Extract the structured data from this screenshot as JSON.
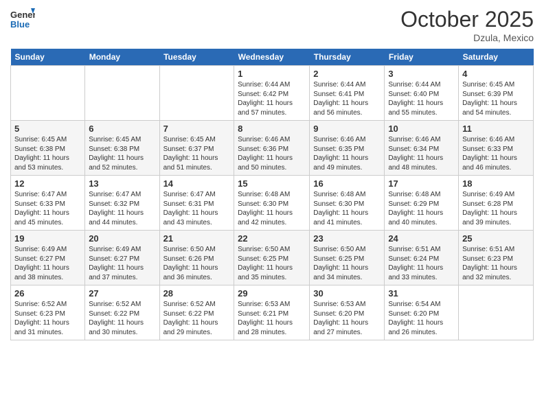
{
  "header": {
    "logo_line1": "General",
    "logo_line2": "Blue",
    "month": "October 2025",
    "location": "Dzula, Mexico"
  },
  "days_of_week": [
    "Sunday",
    "Monday",
    "Tuesday",
    "Wednesday",
    "Thursday",
    "Friday",
    "Saturday"
  ],
  "weeks": [
    [
      {
        "day": "",
        "info": ""
      },
      {
        "day": "",
        "info": ""
      },
      {
        "day": "",
        "info": ""
      },
      {
        "day": "1",
        "info": "Sunrise: 6:44 AM\nSunset: 6:42 PM\nDaylight: 11 hours\nand 57 minutes."
      },
      {
        "day": "2",
        "info": "Sunrise: 6:44 AM\nSunset: 6:41 PM\nDaylight: 11 hours\nand 56 minutes."
      },
      {
        "day": "3",
        "info": "Sunrise: 6:44 AM\nSunset: 6:40 PM\nDaylight: 11 hours\nand 55 minutes."
      },
      {
        "day": "4",
        "info": "Sunrise: 6:45 AM\nSunset: 6:39 PM\nDaylight: 11 hours\nand 54 minutes."
      }
    ],
    [
      {
        "day": "5",
        "info": "Sunrise: 6:45 AM\nSunset: 6:38 PM\nDaylight: 11 hours\nand 53 minutes."
      },
      {
        "day": "6",
        "info": "Sunrise: 6:45 AM\nSunset: 6:38 PM\nDaylight: 11 hours\nand 52 minutes."
      },
      {
        "day": "7",
        "info": "Sunrise: 6:45 AM\nSunset: 6:37 PM\nDaylight: 11 hours\nand 51 minutes."
      },
      {
        "day": "8",
        "info": "Sunrise: 6:46 AM\nSunset: 6:36 PM\nDaylight: 11 hours\nand 50 minutes."
      },
      {
        "day": "9",
        "info": "Sunrise: 6:46 AM\nSunset: 6:35 PM\nDaylight: 11 hours\nand 49 minutes."
      },
      {
        "day": "10",
        "info": "Sunrise: 6:46 AM\nSunset: 6:34 PM\nDaylight: 11 hours\nand 48 minutes."
      },
      {
        "day": "11",
        "info": "Sunrise: 6:46 AM\nSunset: 6:33 PM\nDaylight: 11 hours\nand 46 minutes."
      }
    ],
    [
      {
        "day": "12",
        "info": "Sunrise: 6:47 AM\nSunset: 6:33 PM\nDaylight: 11 hours\nand 45 minutes."
      },
      {
        "day": "13",
        "info": "Sunrise: 6:47 AM\nSunset: 6:32 PM\nDaylight: 11 hours\nand 44 minutes."
      },
      {
        "day": "14",
        "info": "Sunrise: 6:47 AM\nSunset: 6:31 PM\nDaylight: 11 hours\nand 43 minutes."
      },
      {
        "day": "15",
        "info": "Sunrise: 6:48 AM\nSunset: 6:30 PM\nDaylight: 11 hours\nand 42 minutes."
      },
      {
        "day": "16",
        "info": "Sunrise: 6:48 AM\nSunset: 6:30 PM\nDaylight: 11 hours\nand 41 minutes."
      },
      {
        "day": "17",
        "info": "Sunrise: 6:48 AM\nSunset: 6:29 PM\nDaylight: 11 hours\nand 40 minutes."
      },
      {
        "day": "18",
        "info": "Sunrise: 6:49 AM\nSunset: 6:28 PM\nDaylight: 11 hours\nand 39 minutes."
      }
    ],
    [
      {
        "day": "19",
        "info": "Sunrise: 6:49 AM\nSunset: 6:27 PM\nDaylight: 11 hours\nand 38 minutes."
      },
      {
        "day": "20",
        "info": "Sunrise: 6:49 AM\nSunset: 6:27 PM\nDaylight: 11 hours\nand 37 minutes."
      },
      {
        "day": "21",
        "info": "Sunrise: 6:50 AM\nSunset: 6:26 PM\nDaylight: 11 hours\nand 36 minutes."
      },
      {
        "day": "22",
        "info": "Sunrise: 6:50 AM\nSunset: 6:25 PM\nDaylight: 11 hours\nand 35 minutes."
      },
      {
        "day": "23",
        "info": "Sunrise: 6:50 AM\nSunset: 6:25 PM\nDaylight: 11 hours\nand 34 minutes."
      },
      {
        "day": "24",
        "info": "Sunrise: 6:51 AM\nSunset: 6:24 PM\nDaylight: 11 hours\nand 33 minutes."
      },
      {
        "day": "25",
        "info": "Sunrise: 6:51 AM\nSunset: 6:23 PM\nDaylight: 11 hours\nand 32 minutes."
      }
    ],
    [
      {
        "day": "26",
        "info": "Sunrise: 6:52 AM\nSunset: 6:23 PM\nDaylight: 11 hours\nand 31 minutes."
      },
      {
        "day": "27",
        "info": "Sunrise: 6:52 AM\nSunset: 6:22 PM\nDaylight: 11 hours\nand 30 minutes."
      },
      {
        "day": "28",
        "info": "Sunrise: 6:52 AM\nSunset: 6:22 PM\nDaylight: 11 hours\nand 29 minutes."
      },
      {
        "day": "29",
        "info": "Sunrise: 6:53 AM\nSunset: 6:21 PM\nDaylight: 11 hours\nand 28 minutes."
      },
      {
        "day": "30",
        "info": "Sunrise: 6:53 AM\nSunset: 6:20 PM\nDaylight: 11 hours\nand 27 minutes."
      },
      {
        "day": "31",
        "info": "Sunrise: 6:54 AM\nSunset: 6:20 PM\nDaylight: 11 hours\nand 26 minutes."
      },
      {
        "day": "",
        "info": ""
      }
    ]
  ]
}
